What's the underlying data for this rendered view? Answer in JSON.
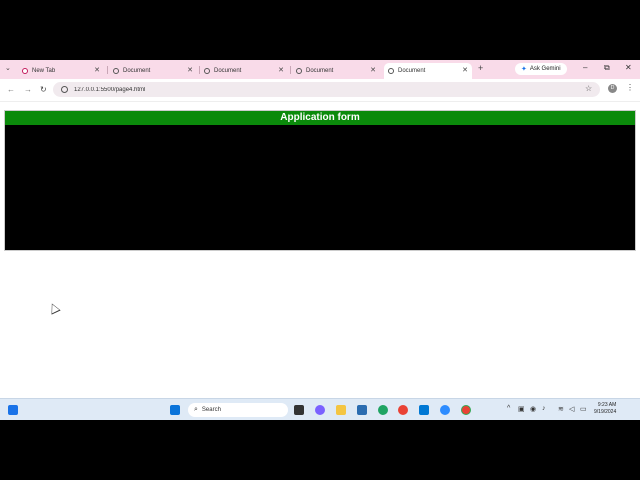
{
  "browser": {
    "tabs": [
      {
        "title": "New Tab",
        "active": false
      },
      {
        "title": "Document",
        "active": false
      },
      {
        "title": "Document",
        "active": false
      },
      {
        "title": "Document",
        "active": false
      },
      {
        "title": "Document",
        "active": true
      }
    ],
    "ask_gemini": "Ask Gemini",
    "address": "127.0.0.1:5500/page4.html",
    "profile_initial": "D"
  },
  "page": {
    "header": "Application form"
  },
  "taskbar": {
    "search_placeholder": "Search",
    "time": "9:23 AM",
    "date": "9/19/2024"
  },
  "colors": {
    "header_bg": "#0b8a0b",
    "form_bg": "#000000",
    "tabstrip_bg": "#f9dbe9"
  }
}
